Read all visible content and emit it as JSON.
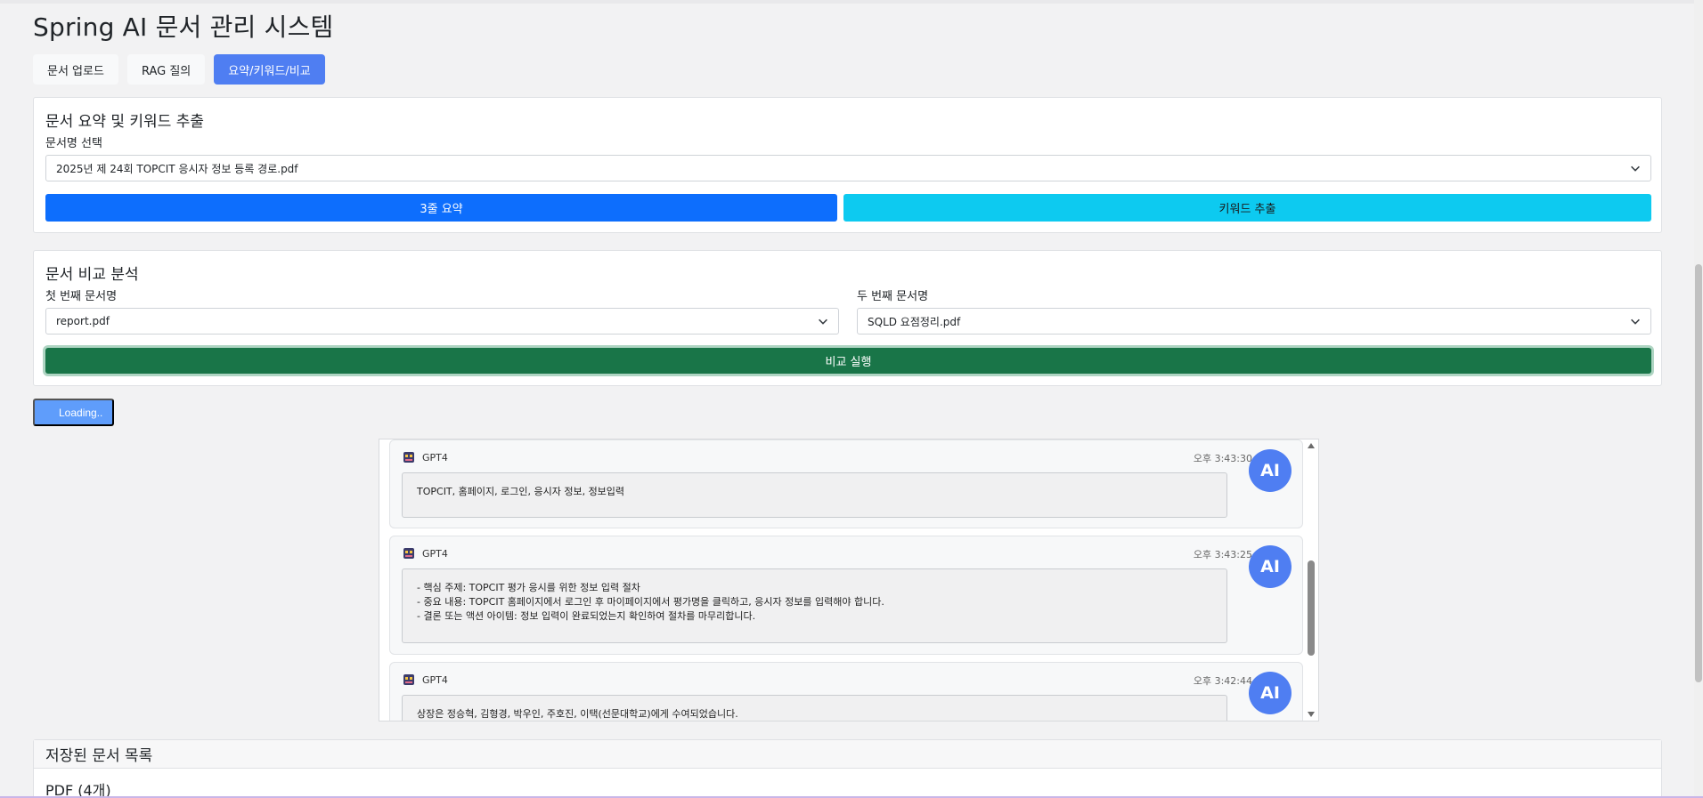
{
  "app": {
    "title": "Spring AI 문서 관리 시스템"
  },
  "tabs": [
    {
      "label": "문서 업로드",
      "active": false
    },
    {
      "label": "RAG 질의",
      "active": false
    },
    {
      "label": "요약/키워드/비교",
      "active": true
    }
  ],
  "summary_card": {
    "title": "문서 요약 및 키워드 추출",
    "doc_label": "문서명 선택",
    "doc_selected": "2025년 제 24회 TOPCIT 응시자 정보 등록 경로.pdf",
    "summary_button": "3줄 요약",
    "keyword_button": "키워드 추출"
  },
  "compare_card": {
    "title": "문서 비교 분석",
    "first_label": "첫 번째 문서명",
    "first_selected": "report.pdf",
    "second_label": "두 번째 문서명",
    "second_selected": "SQLD 요점정리.pdf",
    "run_button": "비교 실행"
  },
  "loading_button": "Loading..",
  "chat": {
    "messages": [
      {
        "sender": "GPT4",
        "time": "오후 3:43:30",
        "avatar": "AI",
        "lines": [
          "TOPCIT, 홈페이지, 로그인, 응시자 정보, 정보입력"
        ]
      },
      {
        "sender": "GPT4",
        "time": "오후 3:43:25",
        "avatar": "AI",
        "lines": [
          "- 핵심 주제: TOPCIT 평가 응시를 위한 정보 입력 절차",
          "- 중요 내용: TOPCIT 홈페이지에서 로그인 후 마이페이지에서 평가명을 클릭하고, 응시자 정보를 입력해야 합니다.",
          "- 결론 또는 액션 아이템: 정보 입력이 완료되었는지 확인하여 절차를 마무리합니다."
        ]
      },
      {
        "sender": "GPT4",
        "time": "오후 3:42:44",
        "avatar": "AI",
        "lines": [
          "상장은 정승혁, 김형경, 박우인, 주호진, 이택(선문대학교)에게 수여되었습니다."
        ]
      }
    ]
  },
  "saved_docs": {
    "title": "저장된 문서 목록",
    "subtitle": "PDF (4개)"
  },
  "colors": {
    "primary": "#0d6efd",
    "info": "#0dcaf0",
    "success": "#197548",
    "tab_active": "#4f7ef2",
    "avatar": "#4f7ef2"
  }
}
